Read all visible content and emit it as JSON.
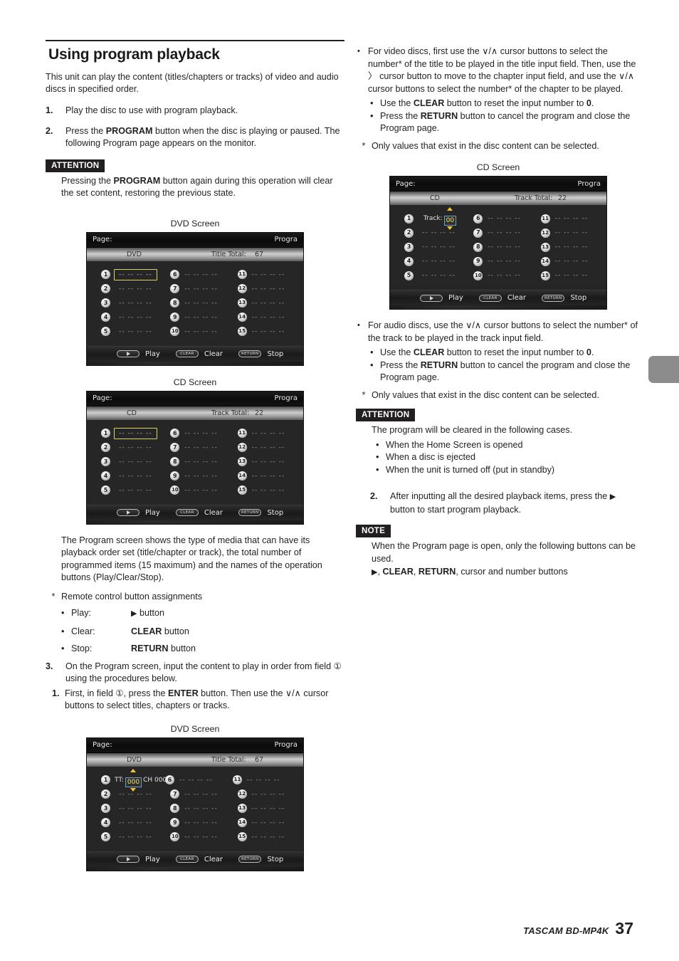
{
  "section": {
    "title": "Using program playback",
    "lead": "This unit can play the content (titles/chapters or tracks) of video and audio discs in specified order."
  },
  "steps_left": [
    {
      "num": "1.",
      "text": "Play the disc to use with program playback."
    },
    {
      "num": "2.",
      "text_a": "Press the ",
      "bold_a": "PROGRAM",
      "text_b": " button when the disc is playing or paused. The following Program page appears on the monitor."
    }
  ],
  "attention_left": {
    "tag": "ATTENTION",
    "text_a": "Pressing the ",
    "bold_a": "PROGRAM",
    "text_b": " button again during this operation will clear the set content, restoring the previous state."
  },
  "captions": {
    "dvd": "DVD Screen",
    "cd": "CD Screen"
  },
  "screen_dvd_empty": {
    "titlebar_left": "Page:",
    "titlebar_right": "Progra",
    "media": "DVD",
    "total_label": "Title Total:",
    "total_value": "67",
    "slot_placeholder": "-- -- -- --",
    "slots": [
      "1",
      "2",
      "3",
      "4",
      "5",
      "6",
      "7",
      "8",
      "9",
      "10",
      "11",
      "12",
      "13",
      "14",
      "15"
    ],
    "selected_slot": "1",
    "footer": {
      "play_key": "",
      "play_label": "Play",
      "clear_key": "CLEAR",
      "clear_label": "Clear",
      "return_key": "RETURN",
      "return_label": "Stop"
    }
  },
  "screen_cd_empty": {
    "titlebar_left": "Page:",
    "titlebar_right": "Progra",
    "media": "CD",
    "total_label": "Track Total:",
    "total_value": "22",
    "slot_placeholder": "-- -- -- --",
    "slots": [
      "1",
      "2",
      "3",
      "4",
      "5",
      "6",
      "7",
      "8",
      "9",
      "10",
      "11",
      "12",
      "13",
      "14",
      "15"
    ],
    "selected_slot": "1",
    "footer": {
      "play_key": "",
      "play_label": "Play",
      "clear_key": "CLEAR",
      "clear_label": "Clear",
      "return_key": "RETURN",
      "return_label": "Stop"
    }
  },
  "screen_dvd_input": {
    "titlebar_left": "Page:",
    "titlebar_right": "Progra",
    "media": "DVD",
    "total_label": "Title Total:",
    "total_value": "67",
    "slot_placeholder": "-- -- -- --",
    "field_title_label": "TT:",
    "field_title_value": "000",
    "field_chapter_label": "CH 000",
    "slots": [
      "1",
      "2",
      "3",
      "4",
      "5",
      "6",
      "7",
      "8",
      "9",
      "10",
      "11",
      "12",
      "13",
      "14",
      "15"
    ],
    "footer": {
      "play_label": "Play",
      "clear_key": "CLEAR",
      "clear_label": "Clear",
      "return_key": "RETURN",
      "return_label": "Stop"
    }
  },
  "screen_cd_input": {
    "titlebar_left": "Page:",
    "titlebar_right": "Progra",
    "media": "CD",
    "total_label": "Track Total:",
    "total_value": "22",
    "slot_placeholder": "-- -- -- --",
    "field_track_label": "Track:",
    "field_track_value": "00",
    "slots": [
      "1",
      "2",
      "3",
      "4",
      "5",
      "6",
      "7",
      "8",
      "9",
      "10",
      "11",
      "12",
      "13",
      "14",
      "15"
    ],
    "footer": {
      "play_label": "Play",
      "clear_key": "CLEAR",
      "clear_label": "Clear",
      "return_key": "RETURN",
      "return_label": "Stop"
    }
  },
  "program_screen_desc": "The Program screen shows the type of media that can have its playback order set (title/chapter or track), the total number of programmed items (15 maximum) and the names of the operation buttons (Play/Clear/Stop).",
  "remote_assignments": {
    "heading": "Remote control button assignments",
    "rows": [
      {
        "label": "Play:",
        "value_bold": "",
        "value_rest": " button",
        "glyph": "▶"
      },
      {
        "label": "Clear:",
        "value_bold": "CLEAR",
        "value_rest": " button",
        "glyph": ""
      },
      {
        "label": "Stop:",
        "value_bold": "RETURN",
        "value_rest": " button",
        "glyph": ""
      }
    ]
  },
  "step3": {
    "num": "3.",
    "text": "On the Program screen, input the content to play in order from field ① using the procedures below."
  },
  "step3_sub1": {
    "num": "1.",
    "text_a": "First, in field ①, press the ",
    "bold_a": "ENTER",
    "text_b": " button. Then use the ∨/∧ cursor buttons to select titles, chapters or tracks."
  },
  "right_video_bullet": {
    "text": "For video discs, first use the ∨/∧ cursor buttons to select the number* of the title to be played in the title input field. Then, use the 〉 cursor button to move to the chapter input field, and use the ∨/∧ cursor buttons to select the number* of the chapter to be played.",
    "sub": [
      {
        "a": "Use the ",
        "b": "CLEAR",
        "c": " button to reset the input number to ",
        "d": "0",
        "e": "."
      },
      {
        "a": "Press the ",
        "b": "RETURN",
        "c": " button to cancel the program and close the Program page.",
        "d": "",
        "e": ""
      }
    ]
  },
  "right_star_1": "Only values that exist in the disc content can be selected.",
  "right_audio_bullet": {
    "text": "For audio discs, use the ∨/∧ cursor buttons to select the number* of the track to be played in the track input field.",
    "sub": [
      {
        "a": "Use the ",
        "b": "CLEAR",
        "c": " button to reset the input number to ",
        "d": "0",
        "e": "."
      },
      {
        "a": "Press the ",
        "b": "RETURN",
        "c": " button to cancel the program and close the Program page.",
        "d": "",
        "e": ""
      }
    ]
  },
  "right_star_2": "Only values that exist in the disc content can be selected.",
  "attention_right": {
    "tag": "ATTENTION",
    "intro": "The program will be cleared in the following cases.",
    "items": [
      "When the Home Screen is opened",
      "When a disc is ejected",
      "When the unit is turned off (put in standby)"
    ]
  },
  "step2_right": {
    "num": "2.",
    "text_a": "After inputting all the desired playback items, press the ",
    "text_b": " button to start program playback."
  },
  "note_right": {
    "tag": "NOTE",
    "text": "When the Program page is open, only the following buttons can be used.",
    "buttons_a": ", ",
    "buttons_clear": "CLEAR",
    "buttons_mid": ", ",
    "buttons_return": "RETURN",
    "buttons_rest": ", cursor and number buttons"
  },
  "page_footer": {
    "brand": "TASCAM BD-MP4K",
    "page_number": "37"
  },
  "colors": {
    "ink": "#231f20",
    "tag_bg": "#231f20",
    "osd_bg": "#262626",
    "osd_select_border": "#d8d46a",
    "osd_field_value": "#f2e96a",
    "side_tab": "#8c8c8c"
  }
}
